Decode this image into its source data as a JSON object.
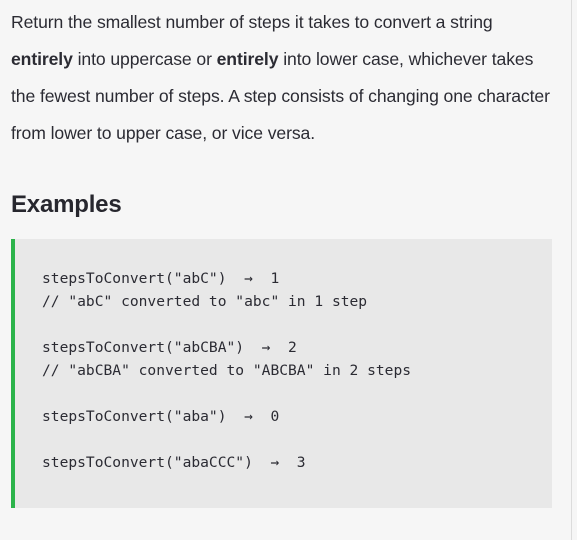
{
  "page": {
    "background_color": "#f6f6f6",
    "text_color": "#2b2b33"
  },
  "description": {
    "part1": "Return the smallest number of steps it takes to convert a string ",
    "bold1": "entirely",
    "part2": " into uppercase or ",
    "bold2": "entirely",
    "part3": " into lower case, whichever takes the fewest number of steps. A step consists of changing one character from lower to upper case, or vice versa."
  },
  "examples_section": {
    "heading": "Examples",
    "code_block": {
      "accent_color": "#2cb34a",
      "background_color": "#e8e8e8",
      "lines": [
        "stepsToConvert(\"abC\")  →  1",
        "// \"abC\" converted to \"abc\" in 1 step",
        "",
        "stepsToConvert(\"abCBA\")  →  2",
        "// \"abCBA\" converted to \"ABCBA\" in 2 steps",
        "",
        "stepsToConvert(\"aba\")  →  0",
        "",
        "stepsToConvert(\"abaCCC\")  →  3"
      ],
      "text": "stepsToConvert(\"abC\")  →  1\n// \"abC\" converted to \"abc\" in 1 step\n\nstepsToConvert(\"abCBA\")  →  2\n// \"abCBA\" converted to \"ABCBA\" in 2 steps\n\nstepsToConvert(\"aba\")  →  0\n\nstepsToConvert(\"abaCCC\")  →  3"
    }
  }
}
